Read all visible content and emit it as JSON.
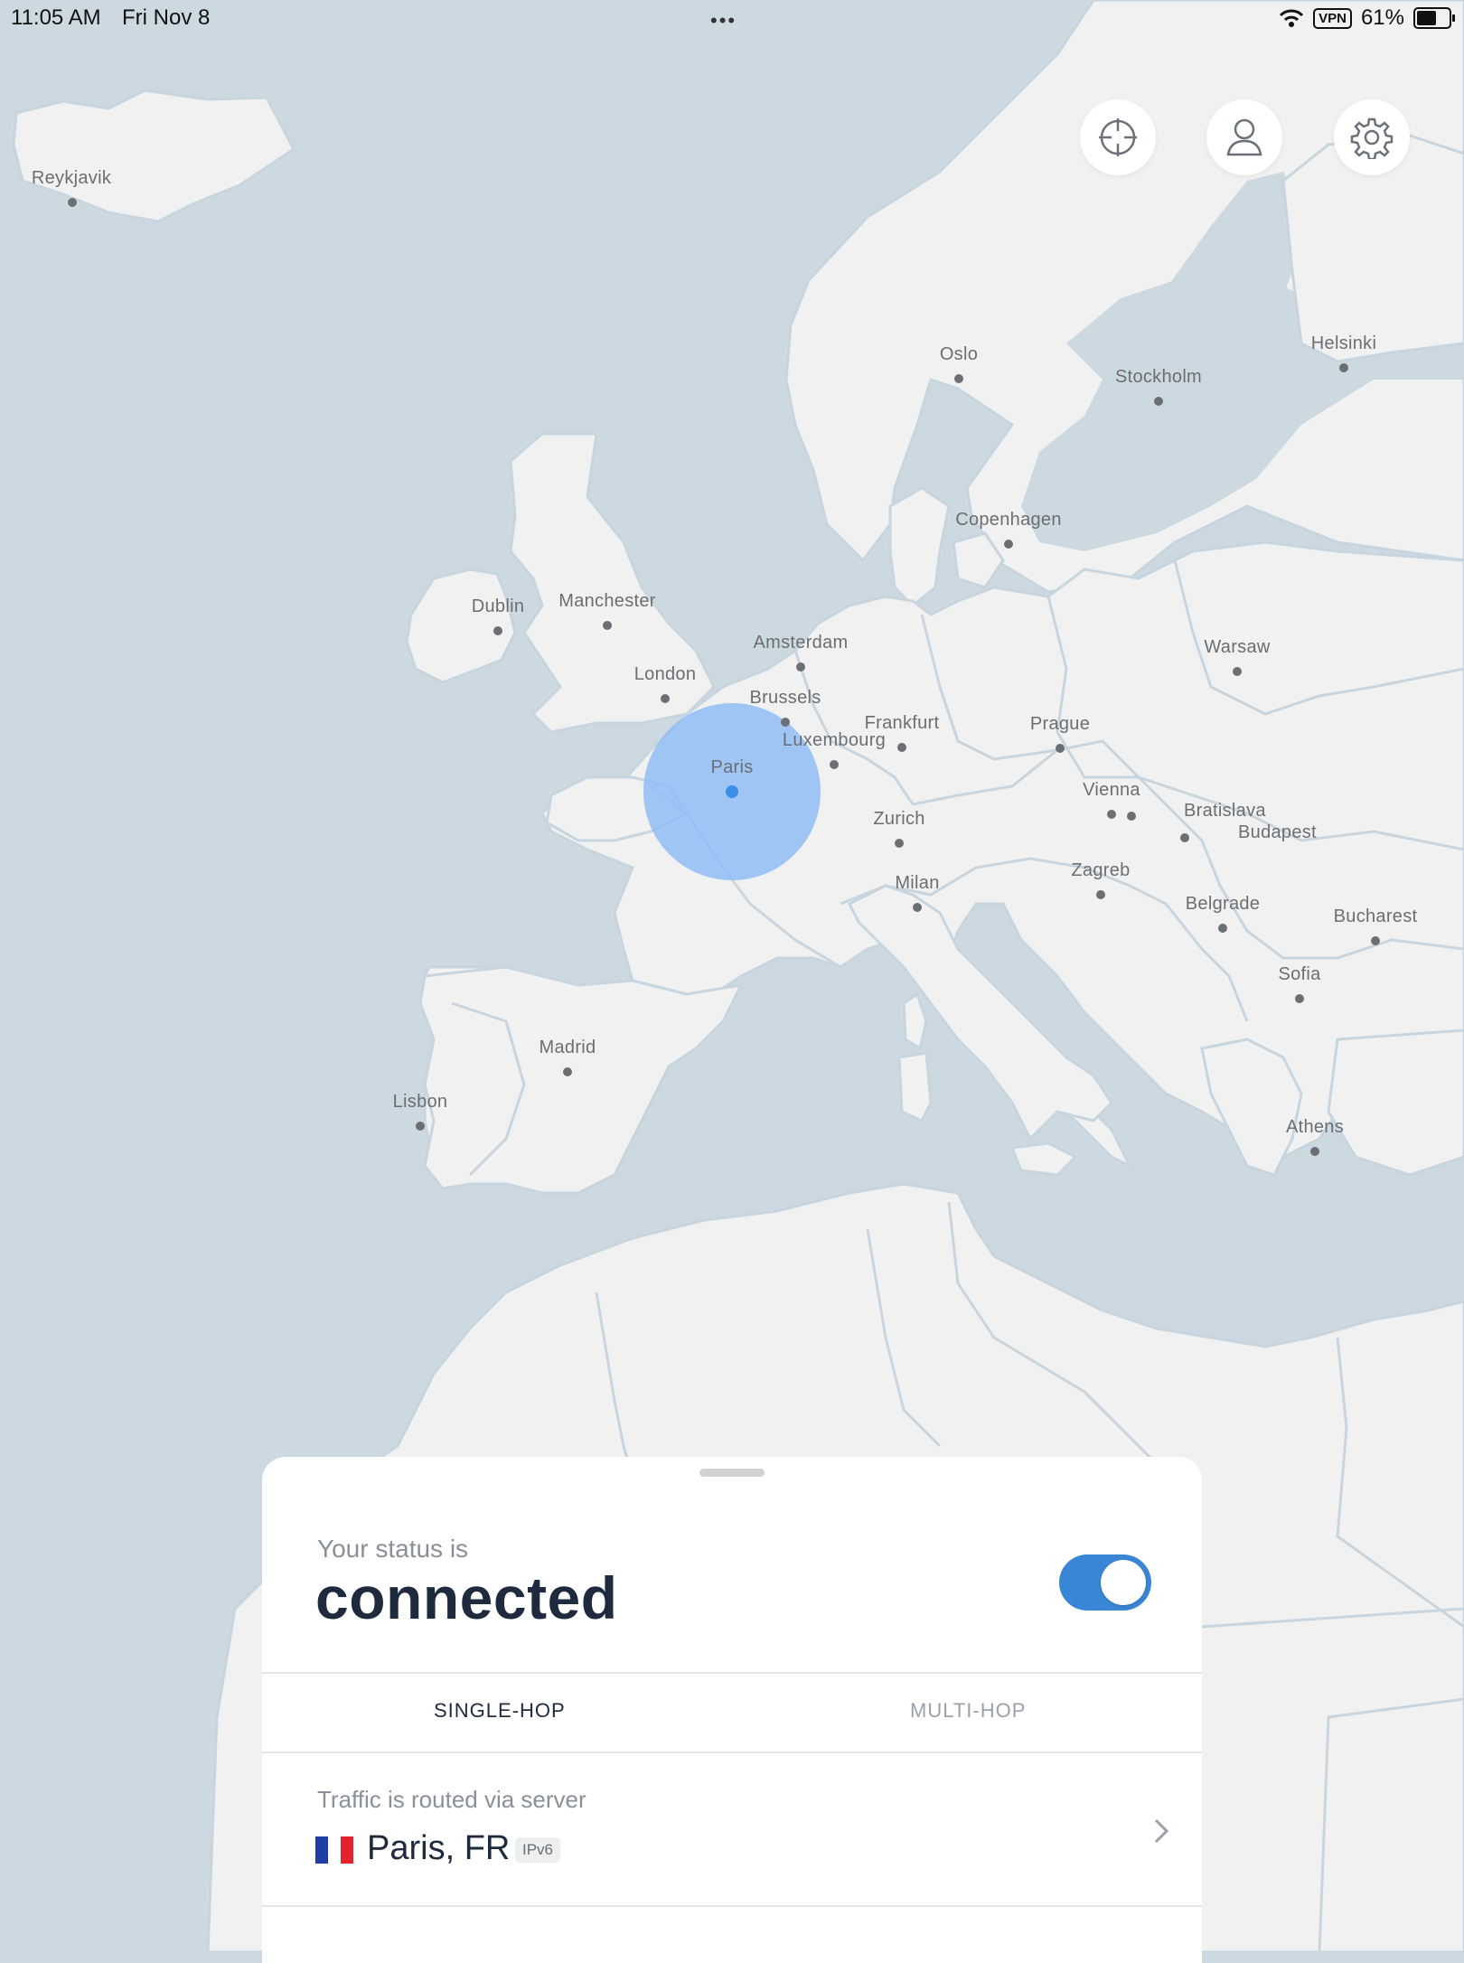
{
  "status_bar": {
    "time": "11:05 AM",
    "date": "Fri Nov 8",
    "dots": "•••",
    "vpn": "VPN",
    "battery": "61%",
    "battery_level": 0.61
  },
  "map": {
    "cities": [
      {
        "name": "Reykjavik"
      },
      {
        "name": "Oslo"
      },
      {
        "name": "Helsinki"
      },
      {
        "name": "Stockholm"
      },
      {
        "name": "Copenhagen"
      },
      {
        "name": "Dublin"
      },
      {
        "name": "Manchester"
      },
      {
        "name": "Amsterdam"
      },
      {
        "name": "Warsaw"
      },
      {
        "name": "London"
      },
      {
        "name": "Brussels"
      },
      {
        "name": "Frankfurt"
      },
      {
        "name": "Luxembourg"
      },
      {
        "name": "Prague"
      },
      {
        "name": "Paris"
      },
      {
        "name": "Vienna"
      },
      {
        "name": "Bratislava"
      },
      {
        "name": "Budapest"
      },
      {
        "name": "Zurich"
      },
      {
        "name": "Zagreb"
      },
      {
        "name": "Milan"
      },
      {
        "name": "Belgrade"
      },
      {
        "name": "Bucharest"
      },
      {
        "name": "Sofia"
      },
      {
        "name": "Madrid"
      },
      {
        "name": "Lisbon"
      },
      {
        "name": "Athens"
      }
    ],
    "connected_city": "Paris",
    "colors": {
      "water": "#cdd9e1",
      "land": "#f1f1f1",
      "highlight": "#8fbdf4",
      "dot": "#3d8ee8"
    }
  },
  "map_buttons": {
    "locate": "crosshair-icon",
    "account": "person-icon",
    "settings": "gear-icon"
  },
  "sheet": {
    "status_label": "Your status is",
    "status_value": "connected",
    "toggle_on": true,
    "tabs": [
      {
        "label": "SINGLE-HOP",
        "active": true
      },
      {
        "label": "MULTI-HOP",
        "active": false
      }
    ],
    "route_label": "Traffic is routed via server",
    "server": "Paris, FR",
    "protocol_badge": "IPv6",
    "colors": {
      "toggle": "#3a86d6",
      "title": "#1e2a3d"
    }
  }
}
